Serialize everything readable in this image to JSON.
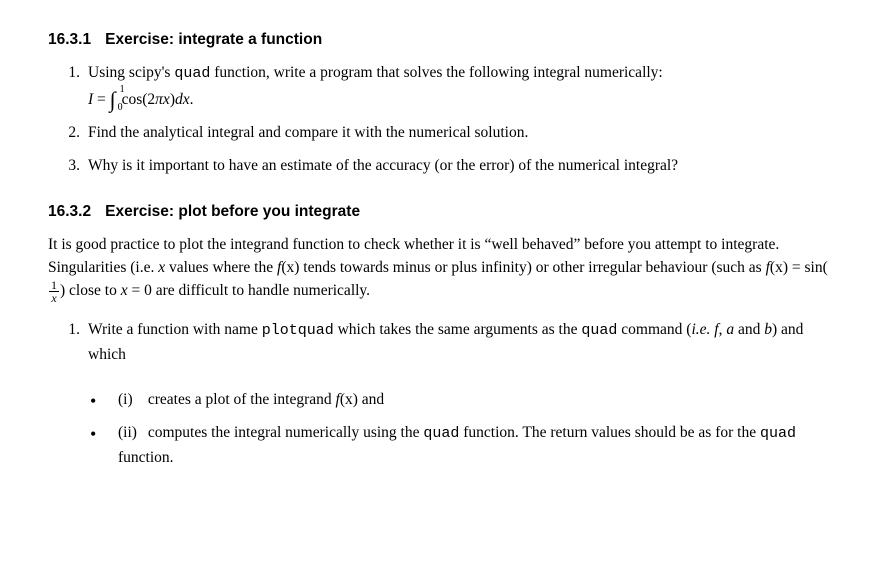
{
  "section1": {
    "number": "16.3.1",
    "title": "Exercise: integrate a function",
    "items": [
      {
        "num": "1.",
        "text_before": "Using scipy's ",
        "tt1": "quad",
        "text_after": " function, write a program that solves the following integral numerically:",
        "integral": {
          "lhs": "I",
          "eq": " = ",
          "upper": "1",
          "lower": "0",
          "integrand_pre": " cos(2",
          "pi": "π",
          "integrand_x": "x",
          "integrand_post": ")",
          "dx_d": "d",
          "dx_x": "x",
          "period": "."
        }
      },
      {
        "num": "2.",
        "text": "Find the analytical integral and compare it with the numerical solution."
      },
      {
        "num": "3.",
        "text": "Why is it important to have an estimate of the accuracy (or the error) of the numerical integral?"
      }
    ]
  },
  "section2": {
    "number": "16.3.2",
    "title": "Exercise: plot before you integrate",
    "para": {
      "p1": "It is good practice to plot the integrand function to check whether it is “well behaved” before you attempt to integrate. Singularities (i.e. ",
      "xvals": "x",
      "p1b": " values where the ",
      "fx": "f",
      "paren_x": "(x)",
      "p2": " tends towards minus or plus infinity) or other irregular behaviour (such as ",
      "fx2": "f",
      "paren_x2": "(x)",
      "eq": " = sin(",
      "frac_num": "1",
      "frac_den": "x",
      "p3": ") close to ",
      "x_eq": "x",
      "eq0": " = 0 are difficult to handle numerically."
    },
    "items": [
      {
        "num": "1.",
        "pre": "Write a function with name ",
        "tt1": "plotquad",
        "mid": " which takes the same arguments as the ",
        "tt2": "quad",
        "post1": " command (",
        "ie": "i.e.",
        "space": " ",
        "f": "f",
        "comma1": ", ",
        "a": "a",
        "and": " and ",
        "b": "b",
        "post2": ") and which"
      }
    ],
    "bullets": [
      {
        "roman": "(i)",
        "pre": " creates a plot of the integrand ",
        "fx": "f",
        "paren_x": "(x)",
        "post": " and"
      },
      {
        "roman": "(ii)",
        "pre": " computes the integral numerically using the ",
        "tt1": "quad",
        "mid": " function. The return values should be as for the ",
        "tt2": "quad",
        "post": " function."
      }
    ]
  }
}
